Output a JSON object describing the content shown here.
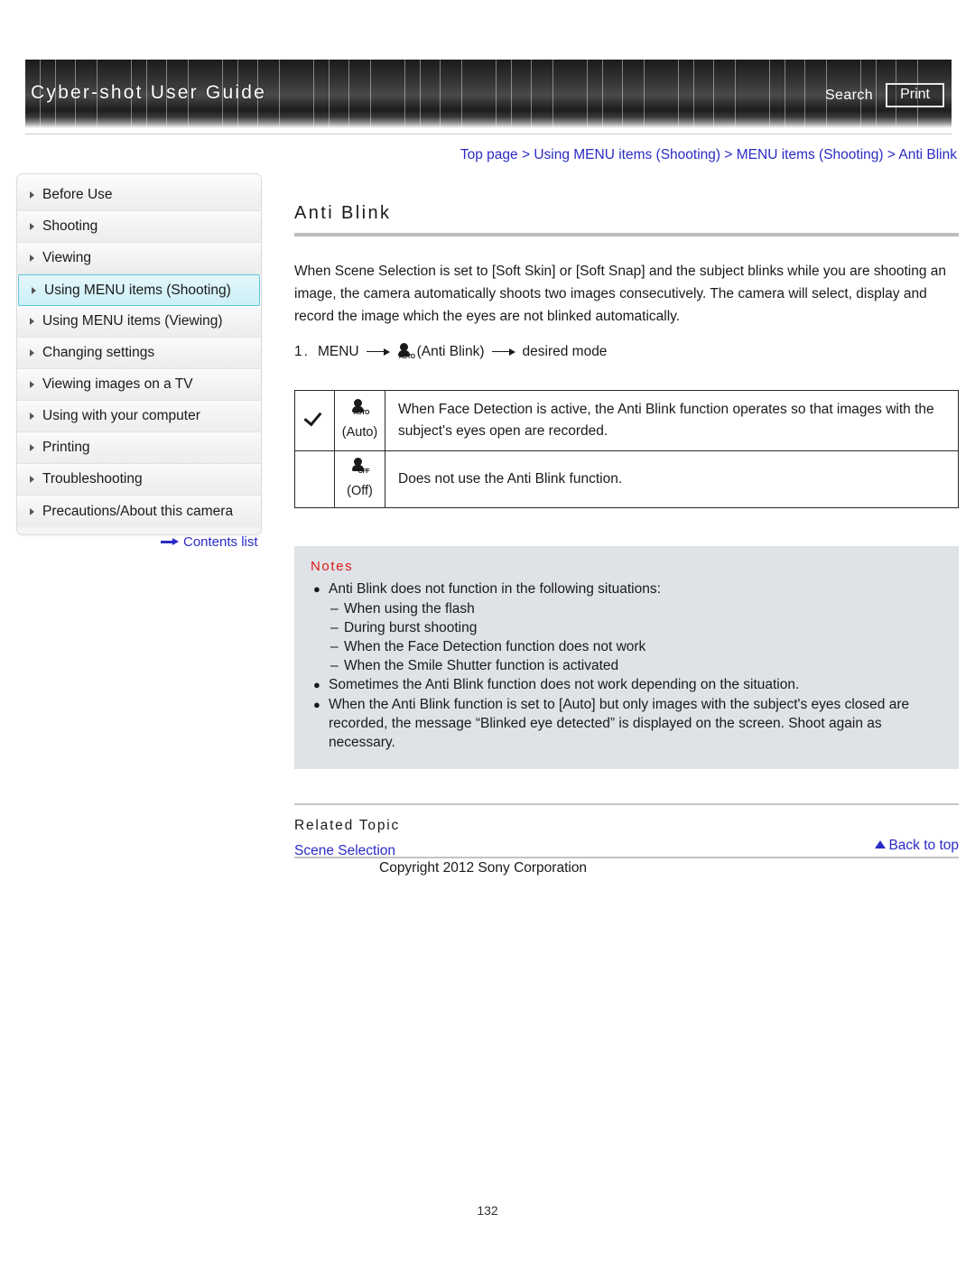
{
  "header": {
    "title": "Cyber-shot User Guide",
    "search_label": "Search",
    "print_label": "Print"
  },
  "breadcrumb": {
    "items": [
      "Top page",
      "Using MENU items (Shooting)",
      "MENU items (Shooting)",
      "Anti Blink"
    ],
    "separator": ">"
  },
  "sidebar": {
    "items": [
      {
        "label": "Before Use",
        "active": false
      },
      {
        "label": "Shooting",
        "active": false
      },
      {
        "label": "Viewing",
        "active": false
      },
      {
        "label": "Using MENU items (Shooting)",
        "active": true
      },
      {
        "label": "Using MENU items (Viewing)",
        "active": false
      },
      {
        "label": "Changing settings",
        "active": false
      },
      {
        "label": "Viewing images on a TV",
        "active": false
      },
      {
        "label": "Using with your computer",
        "active": false
      },
      {
        "label": "Printing",
        "active": false
      },
      {
        "label": "Troubleshooting",
        "active": false
      },
      {
        "label": "Precautions/About this camera",
        "active": false
      }
    ],
    "contents_link": "Contents list"
  },
  "main": {
    "title": "Anti Blink",
    "intro": "When Scene Selection is set to [Soft Skin] or [Soft Snap] and the subject blinks while you are shooting an image, the camera automatically shoots two images consecutively. The camera will select, display and record the image which the eyes are not blinked automatically.",
    "step": {
      "number": "1.",
      "menu_label": "MENU",
      "icon_label": "(Anti Blink)",
      "result": "desired mode"
    },
    "table": {
      "rows": [
        {
          "checked": true,
          "icon_tag": "AUTO",
          "icon_label": "(Auto)",
          "description": "When Face Detection is active, the Anti Blink function operates so that images with the subject's eyes open are recorded."
        },
        {
          "checked": false,
          "icon_tag": "OFF",
          "icon_label": "(Off)",
          "description": "Does not use the Anti Blink function."
        }
      ]
    },
    "notes": {
      "title": "Notes",
      "items": [
        {
          "text": "Anti Blink does not function in the following situations:",
          "sub": [
            "When using the flash",
            "During burst shooting",
            "When the Face Detection function does not work",
            "When the Smile Shutter function is activated"
          ]
        },
        {
          "text": "Sometimes the Anti Blink function does not work depending on the situation.",
          "sub": []
        },
        {
          "text": "When the Anti Blink function is set to [Auto] but only images with the subject's eyes closed are recorded, the message “Blinked eye detected” is displayed on the screen. Shoot again as necessary.",
          "sub": []
        }
      ]
    },
    "related": {
      "title": "Related Topic",
      "links": [
        "Scene Selection"
      ]
    }
  },
  "footer": {
    "back_to_top": "Back to top",
    "copyright": "Copyright 2012 Sony Corporation",
    "page_number": "132"
  }
}
